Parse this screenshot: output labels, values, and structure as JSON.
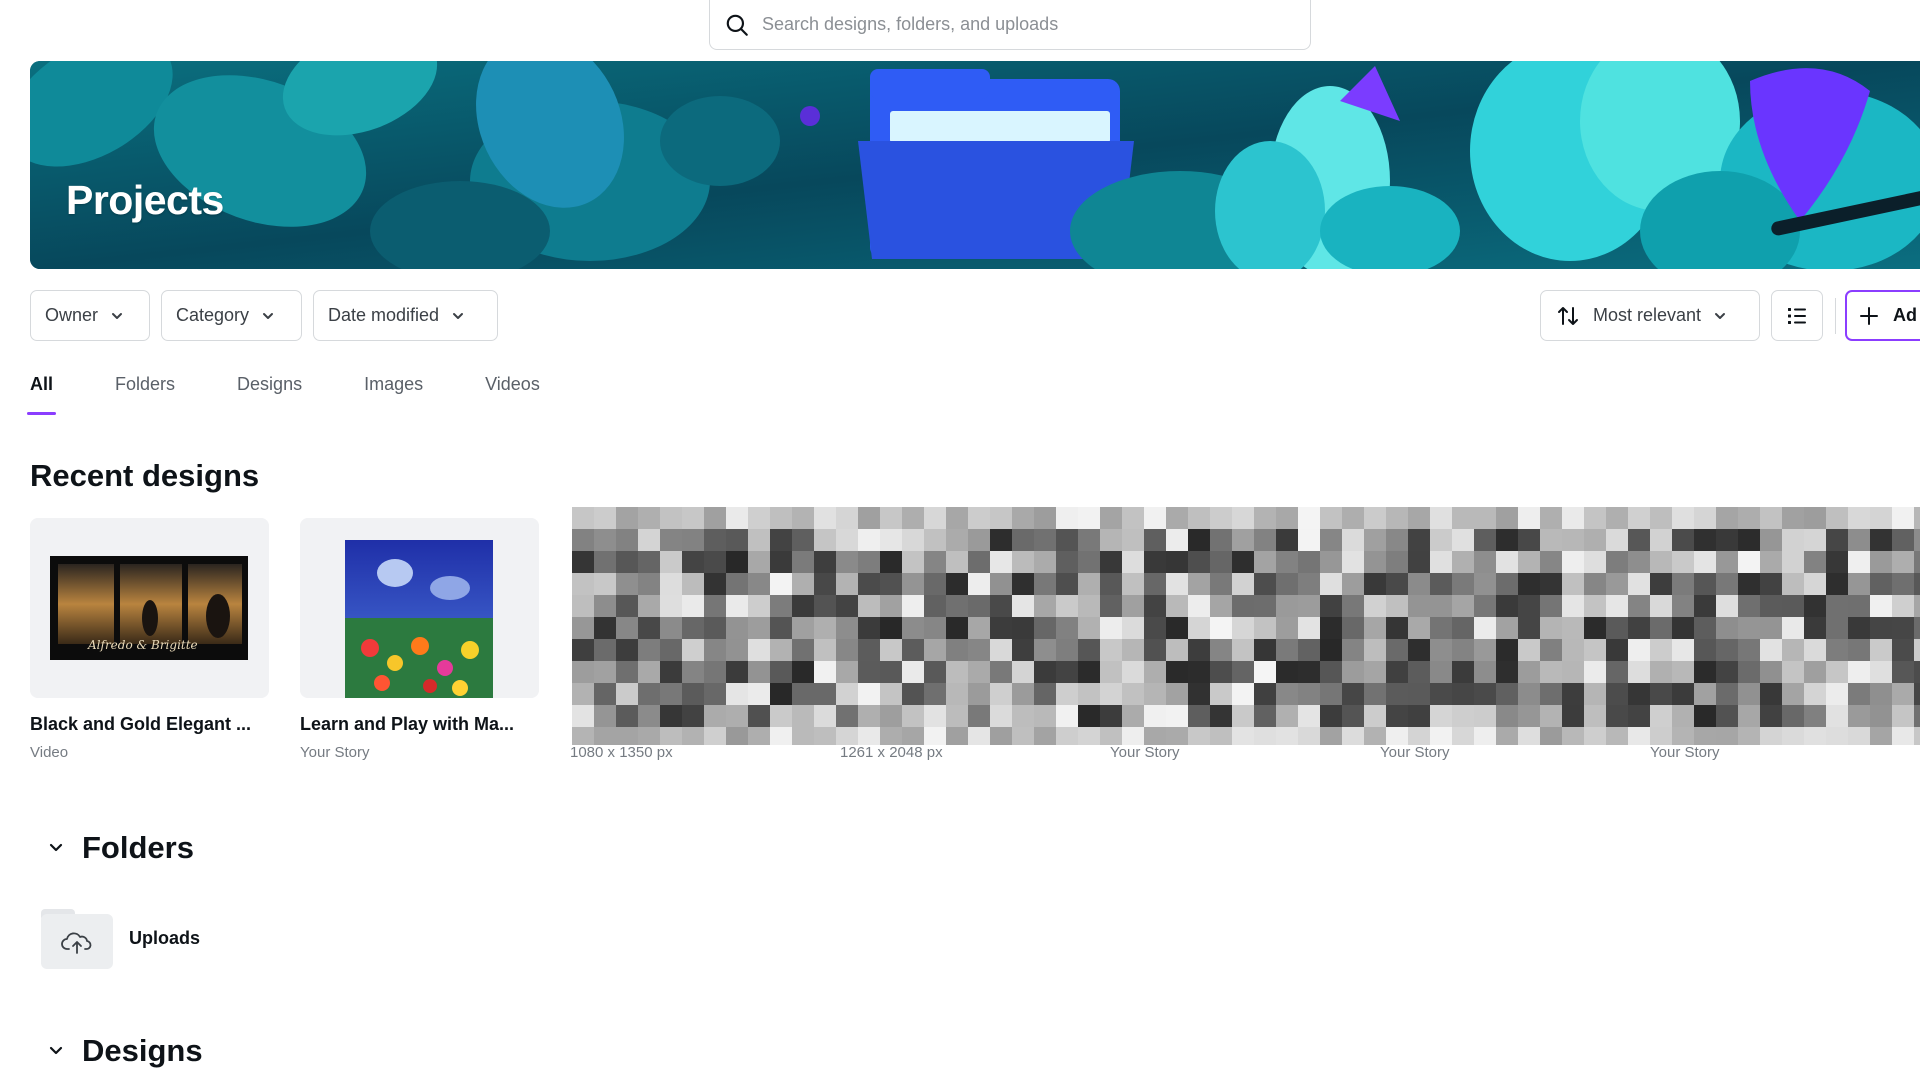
{
  "search": {
    "placeholder": "Search designs, folders, and uploads"
  },
  "banner": {
    "title": "Projects"
  },
  "filters": {
    "owner": "Owner",
    "category": "Category",
    "date": "Date modified",
    "sort": "Most relevant",
    "add": "Ad"
  },
  "tabs": [
    "All",
    "Folders",
    "Designs",
    "Images",
    "Videos"
  ],
  "recent": {
    "title": "Recent designs",
    "cards": [
      {
        "title": "Black and Gold Elegant ...",
        "sub": "Video",
        "thumb_script": "Alfredo & Brigitte"
      },
      {
        "title": "Learn and Play with Ma...",
        "sub": "Your Story"
      }
    ],
    "extra_subs": [
      "1080 x 1350 px",
      "1261 x 2048 px",
      "Your Story",
      "Your Story",
      "Your Story"
    ]
  },
  "folders": {
    "title": "Folders",
    "items": [
      {
        "label": "Uploads"
      }
    ]
  },
  "designs": {
    "title": "Designs"
  },
  "colors": {
    "accent": "#8b3dff",
    "banner_teal": "#0c5e74",
    "folder_blue": "#2f5cf5"
  },
  "icons": [
    "search-icon",
    "chevron-down-icon",
    "sort-icon",
    "list-view-icon",
    "plus-icon",
    "cloud-upload-icon",
    "folder-icon"
  ]
}
